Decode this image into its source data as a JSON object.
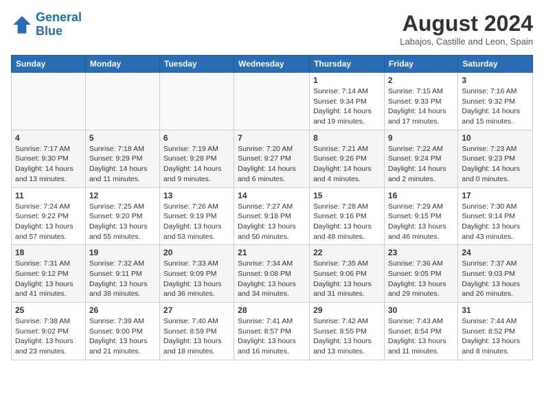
{
  "header": {
    "logo_line1": "General",
    "logo_line2": "Blue",
    "month_year": "August 2024",
    "location": "Labajos, Castille and Leon, Spain"
  },
  "weekdays": [
    "Sunday",
    "Monday",
    "Tuesday",
    "Wednesday",
    "Thursday",
    "Friday",
    "Saturday"
  ],
  "weeks": [
    [
      {
        "day": "",
        "info": ""
      },
      {
        "day": "",
        "info": ""
      },
      {
        "day": "",
        "info": ""
      },
      {
        "day": "",
        "info": ""
      },
      {
        "day": "1",
        "info": "Sunrise: 7:14 AM\nSunset: 9:34 PM\nDaylight: 14 hours\nand 19 minutes."
      },
      {
        "day": "2",
        "info": "Sunrise: 7:15 AM\nSunset: 9:33 PM\nDaylight: 14 hours\nand 17 minutes."
      },
      {
        "day": "3",
        "info": "Sunrise: 7:16 AM\nSunset: 9:32 PM\nDaylight: 14 hours\nand 15 minutes."
      }
    ],
    [
      {
        "day": "4",
        "info": "Sunrise: 7:17 AM\nSunset: 9:30 PM\nDaylight: 14 hours\nand 13 minutes."
      },
      {
        "day": "5",
        "info": "Sunrise: 7:18 AM\nSunset: 9:29 PM\nDaylight: 14 hours\nand 11 minutes."
      },
      {
        "day": "6",
        "info": "Sunrise: 7:19 AM\nSunset: 9:28 PM\nDaylight: 14 hours\nand 9 minutes."
      },
      {
        "day": "7",
        "info": "Sunrise: 7:20 AM\nSunset: 9:27 PM\nDaylight: 14 hours\nand 6 minutes."
      },
      {
        "day": "8",
        "info": "Sunrise: 7:21 AM\nSunset: 9:26 PM\nDaylight: 14 hours\nand 4 minutes."
      },
      {
        "day": "9",
        "info": "Sunrise: 7:22 AM\nSunset: 9:24 PM\nDaylight: 14 hours\nand 2 minutes."
      },
      {
        "day": "10",
        "info": "Sunrise: 7:23 AM\nSunset: 9:23 PM\nDaylight: 14 hours\nand 0 minutes."
      }
    ],
    [
      {
        "day": "11",
        "info": "Sunrise: 7:24 AM\nSunset: 9:22 PM\nDaylight: 13 hours\nand 57 minutes."
      },
      {
        "day": "12",
        "info": "Sunrise: 7:25 AM\nSunset: 9:20 PM\nDaylight: 13 hours\nand 55 minutes."
      },
      {
        "day": "13",
        "info": "Sunrise: 7:26 AM\nSunset: 9:19 PM\nDaylight: 13 hours\nand 53 minutes."
      },
      {
        "day": "14",
        "info": "Sunrise: 7:27 AM\nSunset: 9:18 PM\nDaylight: 13 hours\nand 50 minutes."
      },
      {
        "day": "15",
        "info": "Sunrise: 7:28 AM\nSunset: 9:16 PM\nDaylight: 13 hours\nand 48 minutes."
      },
      {
        "day": "16",
        "info": "Sunrise: 7:29 AM\nSunset: 9:15 PM\nDaylight: 13 hours\nand 46 minutes."
      },
      {
        "day": "17",
        "info": "Sunrise: 7:30 AM\nSunset: 9:14 PM\nDaylight: 13 hours\nand 43 minutes."
      }
    ],
    [
      {
        "day": "18",
        "info": "Sunrise: 7:31 AM\nSunset: 9:12 PM\nDaylight: 13 hours\nand 41 minutes."
      },
      {
        "day": "19",
        "info": "Sunrise: 7:32 AM\nSunset: 9:11 PM\nDaylight: 13 hours\nand 38 minutes."
      },
      {
        "day": "20",
        "info": "Sunrise: 7:33 AM\nSunset: 9:09 PM\nDaylight: 13 hours\nand 36 minutes."
      },
      {
        "day": "21",
        "info": "Sunrise: 7:34 AM\nSunset: 9:08 PM\nDaylight: 13 hours\nand 34 minutes."
      },
      {
        "day": "22",
        "info": "Sunrise: 7:35 AM\nSunset: 9:06 PM\nDaylight: 13 hours\nand 31 minutes."
      },
      {
        "day": "23",
        "info": "Sunrise: 7:36 AM\nSunset: 9:05 PM\nDaylight: 13 hours\nand 29 minutes."
      },
      {
        "day": "24",
        "info": "Sunrise: 7:37 AM\nSunset: 9:03 PM\nDaylight: 13 hours\nand 26 minutes."
      }
    ],
    [
      {
        "day": "25",
        "info": "Sunrise: 7:38 AM\nSunset: 9:02 PM\nDaylight: 13 hours\nand 23 minutes."
      },
      {
        "day": "26",
        "info": "Sunrise: 7:39 AM\nSunset: 9:00 PM\nDaylight: 13 hours\nand 21 minutes."
      },
      {
        "day": "27",
        "info": "Sunrise: 7:40 AM\nSunset: 8:59 PM\nDaylight: 13 hours\nand 18 minutes."
      },
      {
        "day": "28",
        "info": "Sunrise: 7:41 AM\nSunset: 8:57 PM\nDaylight: 13 hours\nand 16 minutes."
      },
      {
        "day": "29",
        "info": "Sunrise: 7:42 AM\nSunset: 8:55 PM\nDaylight: 13 hours\nand 13 minutes."
      },
      {
        "day": "30",
        "info": "Sunrise: 7:43 AM\nSunset: 8:54 PM\nDaylight: 13 hours\nand 11 minutes."
      },
      {
        "day": "31",
        "info": "Sunrise: 7:44 AM\nSunset: 8:52 PM\nDaylight: 13 hours\nand 8 minutes."
      }
    ]
  ]
}
